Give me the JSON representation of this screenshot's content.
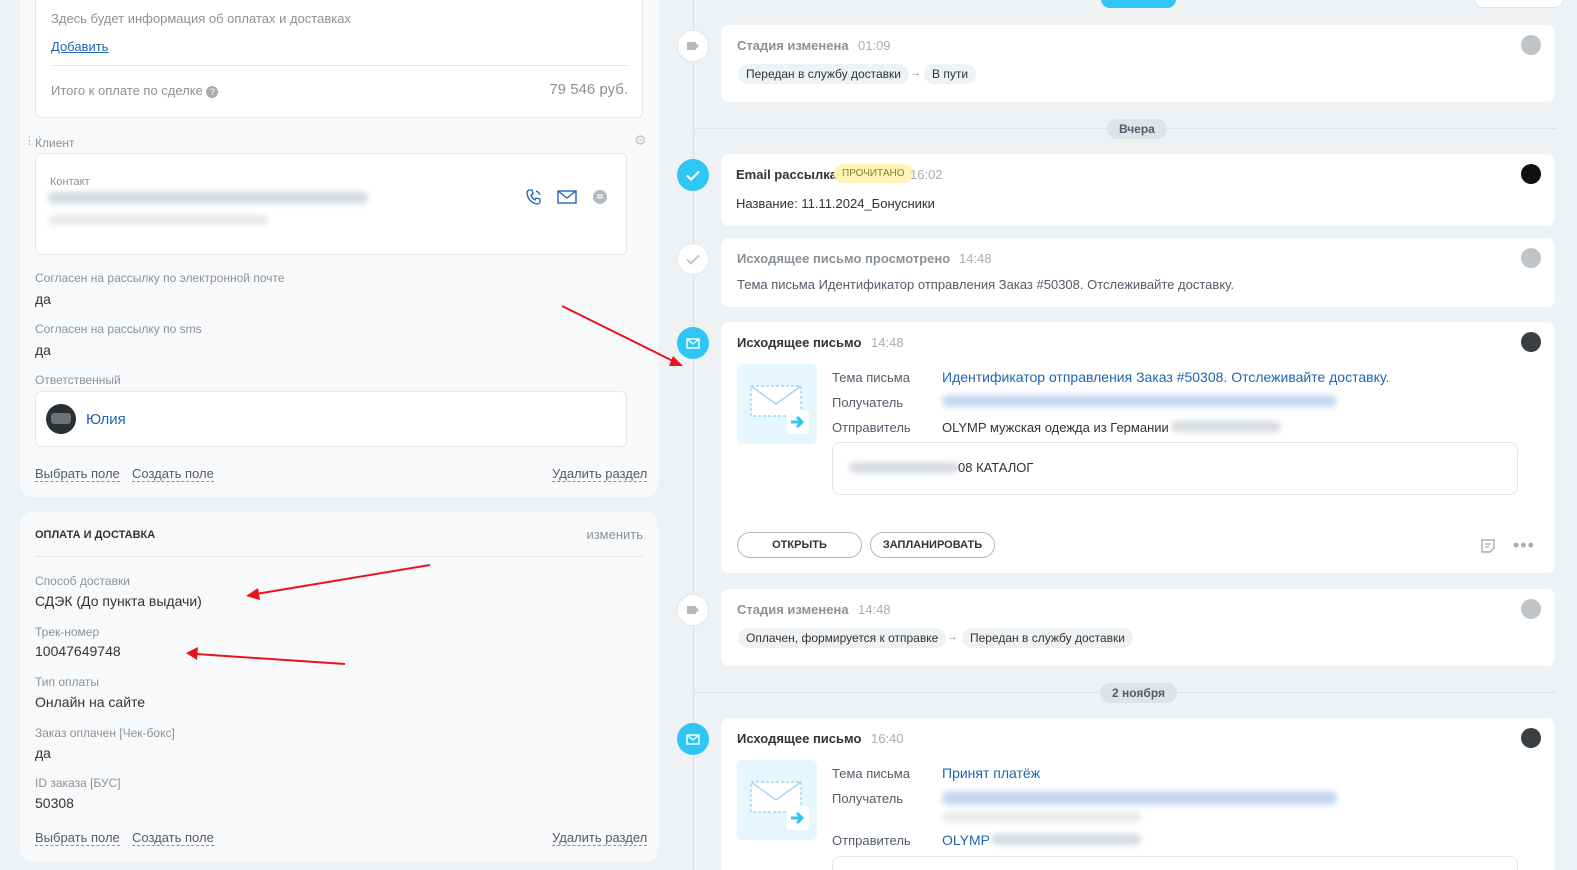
{
  "payments": {
    "placeholder_text": "Здесь будет информация об оплатах и доставках",
    "add_link": "Добавить",
    "total_label": "Итого к оплате по сделке",
    "total_value": "79 546 руб."
  },
  "client": {
    "section_label": "Клиент",
    "contact_label": "Контакт"
  },
  "fields": [
    {
      "label": "Согласен на рассылку по электронной почте",
      "value": "да"
    },
    {
      "label": "Согласен на рассылку по sms",
      "value": "да"
    }
  ],
  "responsible": {
    "label": "Ответственный",
    "name": "Юлия"
  },
  "section_actions": {
    "select_field": "Выбрать поле",
    "create_field": "Создать поле",
    "delete_section": "Удалить раздел"
  },
  "pay_section": {
    "title": "ОПЛАТА И ДОСТАВКА",
    "edit": "изменить",
    "fields": [
      {
        "label": "Способ доставки",
        "value": "СДЭК (До пункта выдачи)"
      },
      {
        "label": "Трек-номер",
        "value": "10047649748"
      },
      {
        "label": "Тип оплаты",
        "value": "Онлайн на сайте"
      },
      {
        "label": "Заказ оплачен [Чек-бокс]",
        "value": "да"
      },
      {
        "label": "ID заказа [БУС]",
        "value": "50308"
      }
    ]
  },
  "timeline": {
    "date_yesterday": "Вчера",
    "date_nov2": "2 ноября",
    "stage1": {
      "title": "Стадия изменена",
      "time": "01:09",
      "from": "Передан в службу доставки",
      "to": "В пути"
    },
    "email_campaign": {
      "title": "Email рассылка",
      "badge": "ПРОЧИТАНО",
      "time": "16:02",
      "text": "Название: 11.11.2024_Бонусники"
    },
    "viewed": {
      "title": "Исходящее письмо просмотрено",
      "time": "14:48",
      "text": "Тема письма Идентификатор отправления Заказ #50308. Отслеживайте доставку."
    },
    "outgoing1": {
      "title": "Исходящее письмо",
      "time": "14:48",
      "subject_label": "Тема письма",
      "subject": "Идентификатор отправления Заказ #50308. Отслеживайте доставку.",
      "recipient_label": "Получатель",
      "sender_label": "Отправитель",
      "sender": "OLYMP мужская одежда из Германии",
      "body": "08 КАТАЛОГ",
      "open_btn": "ОТКРЫТЬ",
      "plan_btn": "ЗАПЛАНИРОВАТЬ"
    },
    "stage2": {
      "title": "Стадия изменена",
      "time": "14:48",
      "from": "Оплачен, формируется к отправке",
      "to": "Передан в службу доставки"
    },
    "outgoing2": {
      "title": "Исходящее письмо",
      "time": "16:40",
      "subject_label": "Тема письма",
      "subject": "Принят платёж",
      "recipient_label": "Получатель",
      "sender_label": "Отправитель",
      "sender": "OLYMP"
    }
  },
  "colors": {
    "accent": "#2fc6f6",
    "link": "#2066b0",
    "annotation": "#e8141b"
  }
}
